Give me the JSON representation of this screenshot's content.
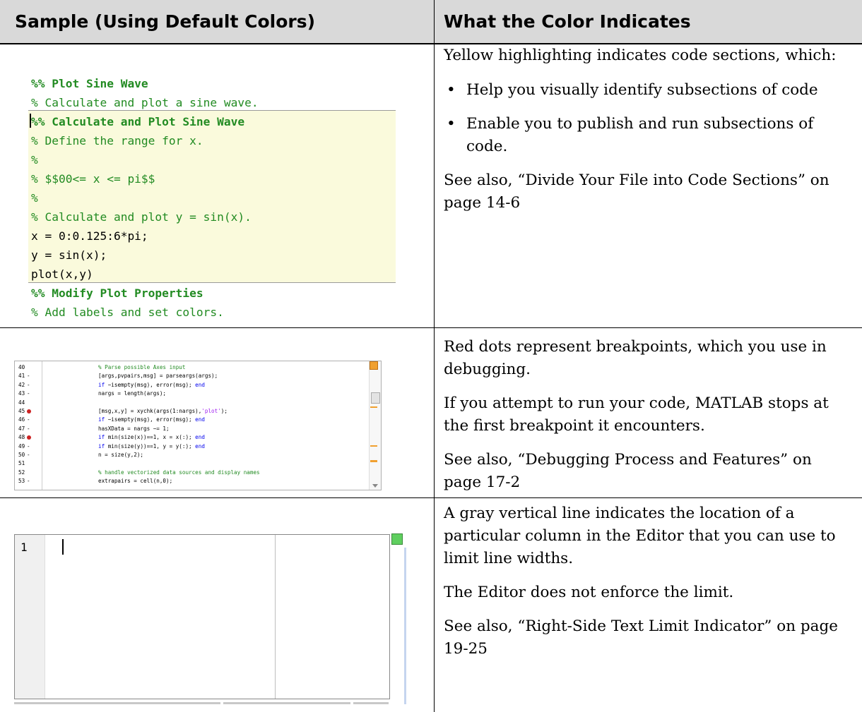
{
  "header": {
    "col1": "Sample (Using Default Colors)",
    "col2": "What the Color Indicates"
  },
  "sample1": {
    "lines": [
      {
        "text": "%% Plot Sine Wave",
        "style": "hd"
      },
      {
        "text": "% Calculate and plot a sine wave.",
        "style": "cmt"
      },
      {
        "text": "%% Calculate and Plot Sine Wave",
        "style": "hd"
      },
      {
        "text": "% Define the range for x.",
        "style": "cmt"
      },
      {
        "text": "%",
        "style": "cmt"
      },
      {
        "text": "% $$00<= x <= pi$$",
        "style": "cmt"
      },
      {
        "text": "%",
        "style": "cmt"
      },
      {
        "text": "% Calculate and plot y = sin(x).",
        "style": "cmt"
      },
      {
        "text": "x = 0:0.125:6*pi;",
        "style": "code"
      },
      {
        "text": "y = sin(x);",
        "style": "code"
      },
      {
        "text": "plot(x,y)",
        "style": "code"
      },
      {
        "text": "%% Modify Plot Properties",
        "style": "hd"
      },
      {
        "text": "% Add labels and set colors.",
        "style": "cmt"
      }
    ],
    "highlight_color": "#fafadc"
  },
  "row1": {
    "p1": "Yellow highlighting indicates code sections, which:",
    "bullets": [
      "Help you visually identify subsections of code",
      "Enable you to publish and run subsections of code."
    ],
    "see_also": "See also, “Divide Your File into Code Sections” on page 14-6"
  },
  "sample2": {
    "rows": [
      {
        "n": "40",
        "mark": "",
        "code": [
          {
            "t": "% Parse possible Axes input",
            "c": "cm"
          }
        ]
      },
      {
        "n": "41",
        "mark": "-",
        "code": [
          {
            "t": "[args,pvpairs,msg] = parseargs(args);",
            "c": ""
          }
        ]
      },
      {
        "n": "42",
        "mark": "-",
        "code": [
          {
            "t": "if",
            "c": "kw"
          },
          {
            "t": " ~isempty(msg), error(msg); ",
            "c": ""
          },
          {
            "t": "end",
            "c": "kw"
          }
        ]
      },
      {
        "n": "43",
        "mark": "-",
        "code": [
          {
            "t": "nargs = length(args);",
            "c": ""
          }
        ]
      },
      {
        "n": "44",
        "mark": "",
        "code": []
      },
      {
        "n": "45",
        "mark": "bp",
        "code": [
          {
            "t": "[msg,x,y] = xychk(args(1:nargs),",
            "c": ""
          },
          {
            "t": "'plot'",
            "c": "st"
          },
          {
            "t": ");",
            "c": ""
          }
        ]
      },
      {
        "n": "46",
        "mark": "-",
        "code": [
          {
            "t": "if",
            "c": "kw"
          },
          {
            "t": " ~isempty(msg), error(msg); ",
            "c": ""
          },
          {
            "t": "end",
            "c": "kw"
          }
        ]
      },
      {
        "n": "47",
        "mark": "-",
        "code": [
          {
            "t": "hasXData = nargs ~= 1;",
            "c": ""
          }
        ]
      },
      {
        "n": "48",
        "mark": "bp",
        "code": [
          {
            "t": "if",
            "c": "kw"
          },
          {
            "t": " min(size(x))==1, x = x(:); ",
            "c": ""
          },
          {
            "t": "end",
            "c": "kw"
          }
        ]
      },
      {
        "n": "49",
        "mark": "-",
        "code": [
          {
            "t": "if",
            "c": "kw"
          },
          {
            "t": " min(size(y))==1, y = y(:); ",
            "c": ""
          },
          {
            "t": "end",
            "c": "kw"
          }
        ]
      },
      {
        "n": "50",
        "mark": "-",
        "code": [
          {
            "t": "n = size(y,2);",
            "c": ""
          }
        ]
      },
      {
        "n": "51",
        "mark": "",
        "code": []
      },
      {
        "n": "52",
        "mark": "",
        "code": [
          {
            "t": "% handle vectorized data sources and display names",
            "c": "cm"
          }
        ]
      },
      {
        "n": "53",
        "mark": "-",
        "code": [
          {
            "t": "extrapairs = cell(n,0);",
            "c": ""
          }
        ]
      }
    ]
  },
  "row2": {
    "p1": "Red dots represent breakpoints, which you use in debugging.",
    "p2": "If you attempt to run your code, MATLAB stops at the first breakpoint it encounters.",
    "see_also": "See also, “Debugging Process and Features” on page 17-2"
  },
  "sample3": {
    "line_number": "1"
  },
  "row3": {
    "p1": "A gray vertical line indicates the location of a particular column in the Editor that you can use to limit line widths.",
    "p2": "The Editor does not enforce the limit.",
    "see_also": "See also, “Right-Side Text Limit Indicator” on page 19-25"
  }
}
